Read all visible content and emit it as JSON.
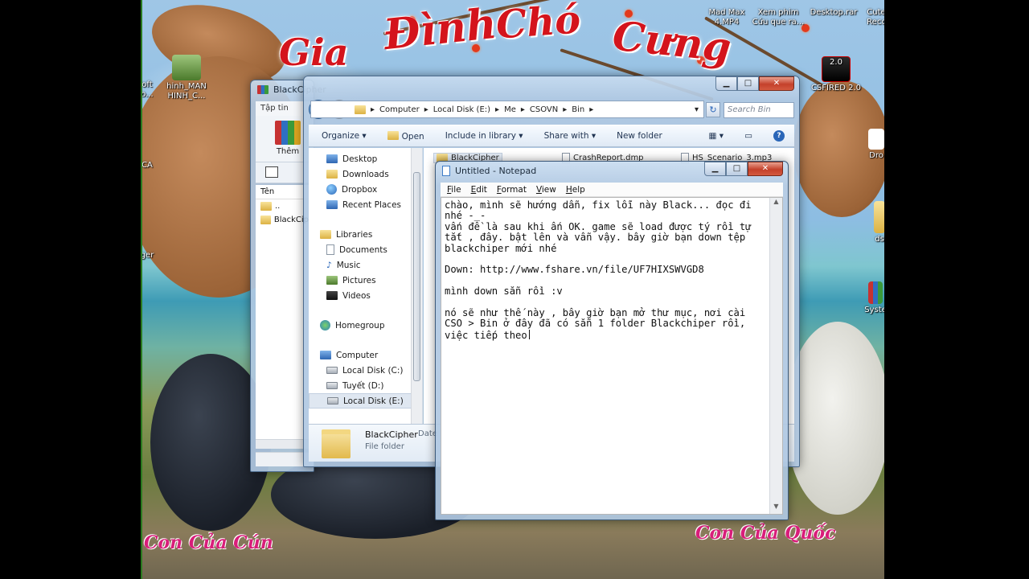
{
  "wallpaper": {
    "title_words": [
      "Gia",
      "Đình",
      "Chó",
      "Cưng"
    ],
    "caption_left": "Con Của Cún",
    "caption_right": "Con Của Quốc"
  },
  "desktop_icons": [
    {
      "label": "hinh_MAN HINH_C...",
      "name": "desktop-icon-hinh-man-hinh"
    },
    {
      "label": "Mad Max 4.MP4",
      "name": "desktop-icon-mad-max"
    },
    {
      "label": "Xem phim Cứu que ra...",
      "name": "desktop-icon-xem-phim"
    },
    {
      "label": "Desktop.rar",
      "name": "desktop-icon-desktop-rar"
    },
    {
      "label": "Cute Recc",
      "name": "desktop-icon-cute"
    },
    {
      "label": "CSFIRED 2.0",
      "name": "desktop-icon-csfired"
    },
    {
      "label": "Dro",
      "name": "desktop-icon-dropbox"
    },
    {
      "label": "ds",
      "name": "desktop-icon-ds"
    },
    {
      "label": "Syste",
      "name": "desktop-icon-system"
    },
    {
      "label": "oft o...",
      "name": "desktop-icon-left-1"
    },
    {
      "label": "CA",
      "name": "desktop-icon-left-2"
    },
    {
      "label": "ger",
      "name": "desktop-icon-left-3"
    }
  ],
  "winrar": {
    "title": "BlackCipher",
    "menu_first": "Tập tin",
    "add_label": "Thêm",
    "col_name": "Tên",
    "items": [
      "..",
      "BlackCip"
    ]
  },
  "explorer": {
    "breadcrumb": [
      "Computer",
      "Local Disk (E:)",
      "Me",
      "CSOVN",
      "Bin"
    ],
    "search_placeholder": "Search Bin",
    "commands": [
      "Organize ▾",
      "Open",
      "Include in library ▾",
      "Share with ▾",
      "New folder"
    ],
    "nav": {
      "favorites": [
        "Desktop",
        "Downloads",
        "Dropbox",
        "Recent Places"
      ],
      "libraries_label": "Libraries",
      "libraries": [
        "Documents",
        "Music",
        "Pictures",
        "Videos"
      ],
      "homegroup": "Homegroup",
      "computer_label": "Computer",
      "drives": [
        "Local Disk (C:)",
        "Tuyết (D:)",
        "Local Disk (E:)"
      ]
    },
    "files": [
      "BlackCipher",
      "CrashReport.dmp",
      "HS_Scenario_3.mp3"
    ],
    "details": {
      "name": "BlackCipher",
      "type": "File folder",
      "extra": "Date"
    }
  },
  "notepad": {
    "title": "Untitled - Notepad",
    "menu": [
      "File",
      "Edit",
      "Format",
      "View",
      "Help"
    ],
    "content": "chào, mình sẽ hướng dẫn, fix lỗi này Black... đọc đi\nnhé -_-\nvấn đề là sau khi ấn OK. game sẽ load được tý rồi tự\ntắt , đây. bật lên và vẫn vậy. bây giờ bạn down tệp\nblackchiper mới nhé\n\nDown: http://www.fshare.vn/file/UF7HIXSWVGD8\n\nmình down sẵn rồi :v\n\nnó sẽ như thế này , bây giờ bạn mở thư mục, nơi cài\nCSO > Bin ở đây đã có sẵn 1 folder Blackchiper rồi,\nviệc tiếp theo"
  },
  "colors": {
    "title_red": "#d4141c",
    "caption_pink": "#d81e7a",
    "window_frame": "#b0c8e2",
    "close_red": "#c4412b"
  }
}
